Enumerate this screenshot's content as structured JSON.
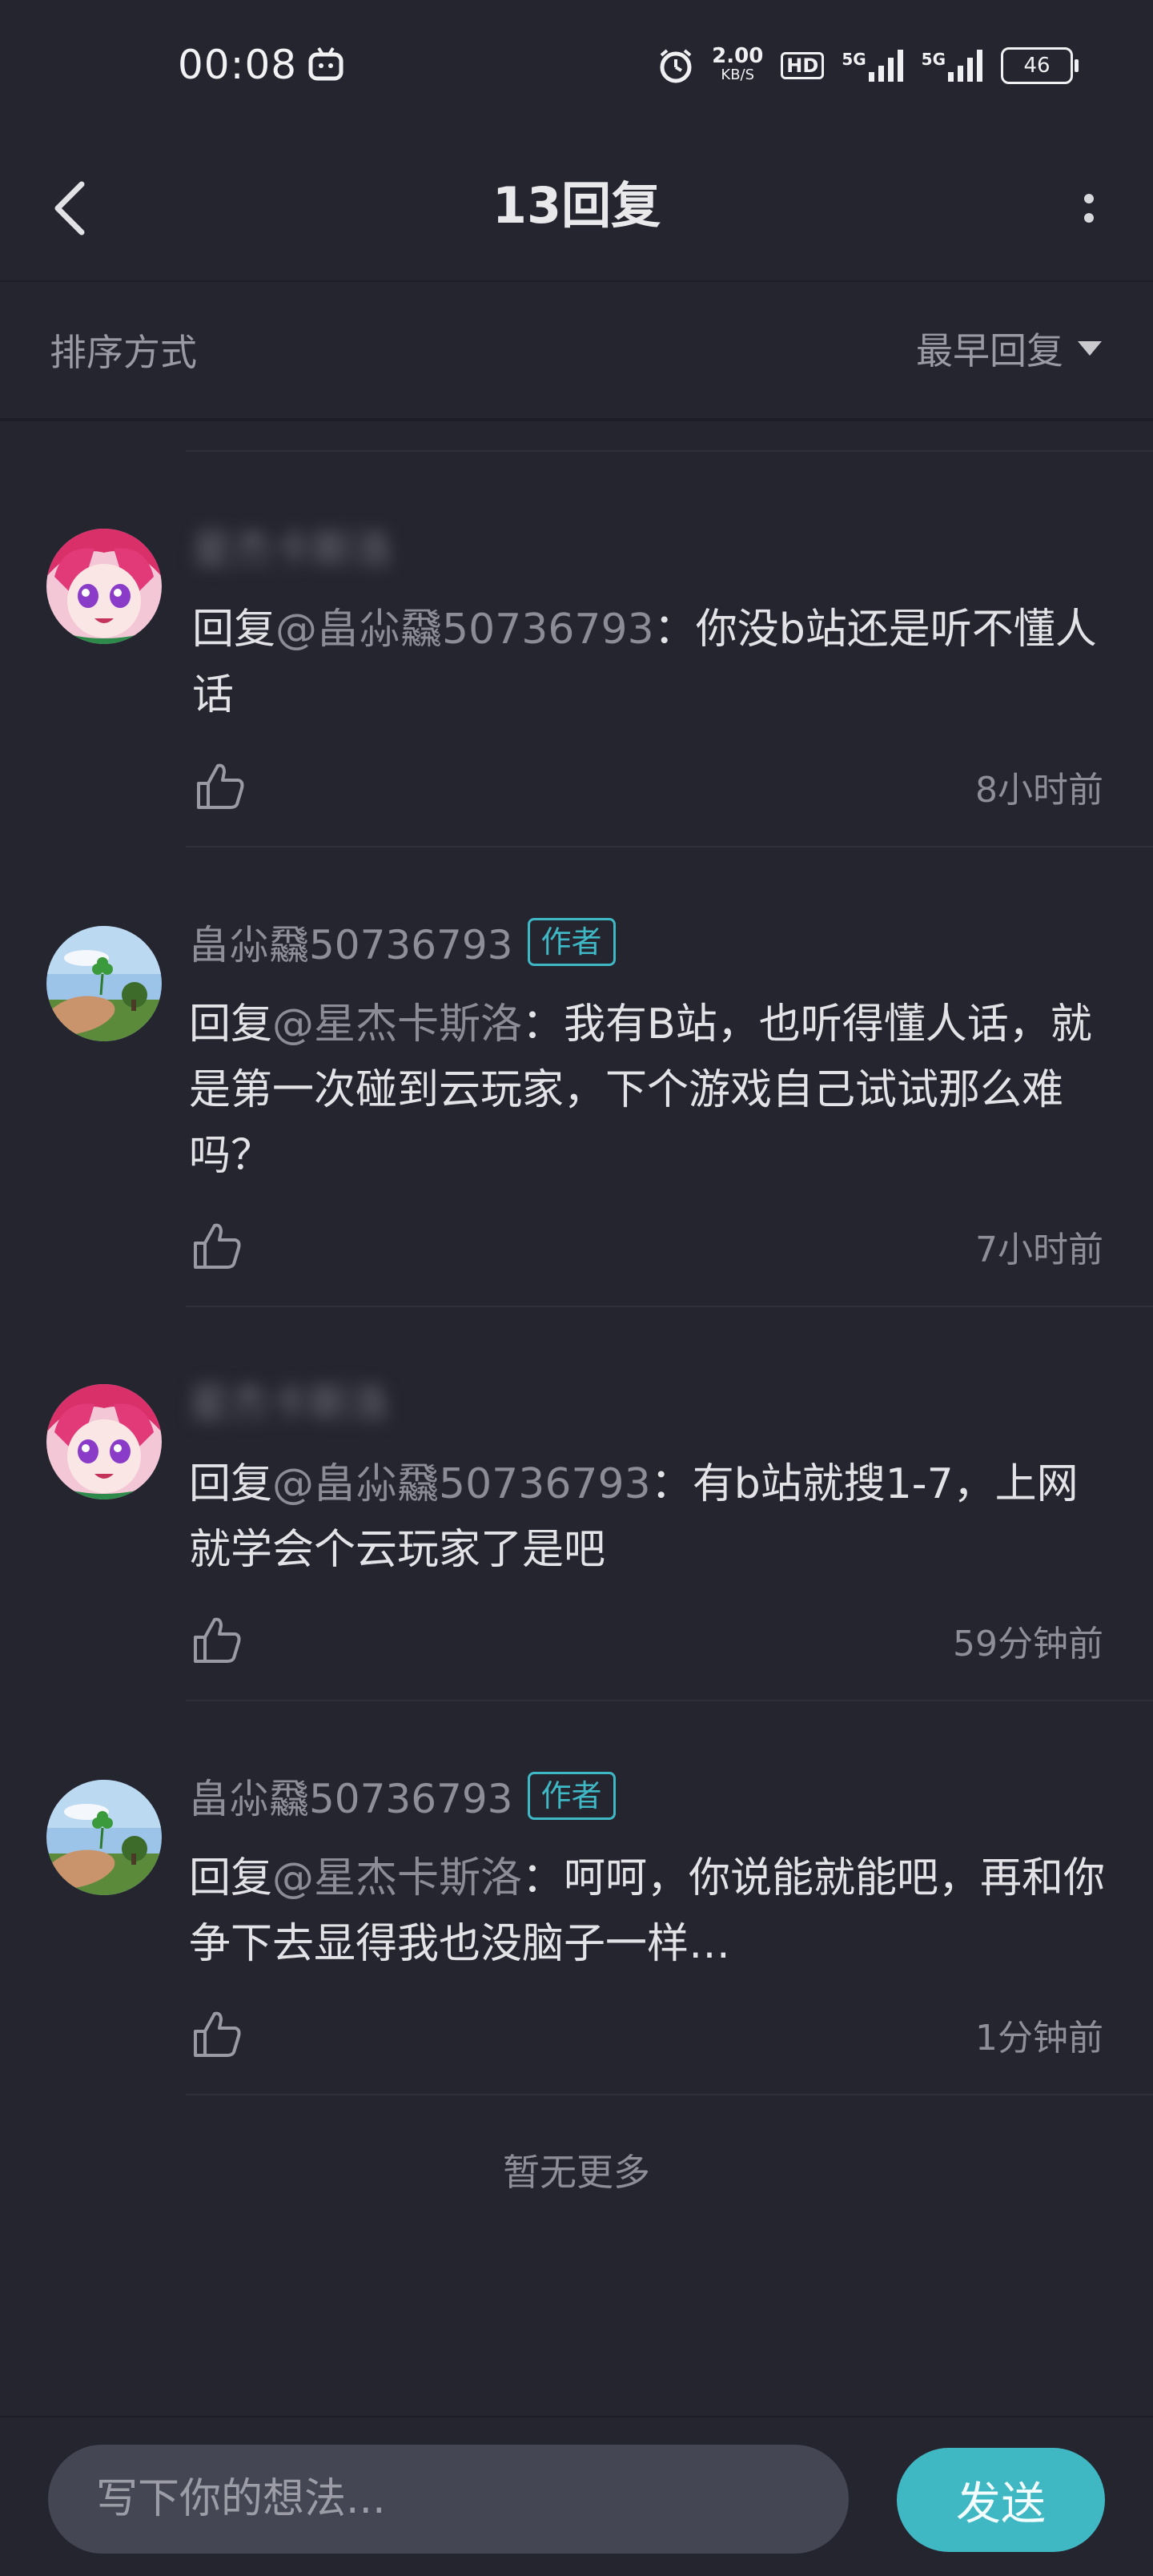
{
  "status_bar": {
    "time": "00:08",
    "net_speed_value": "2.00",
    "net_speed_unit": "KB/S",
    "hd_label": "HD",
    "signal_1": "5G",
    "signal_2": "5G",
    "battery": "46"
  },
  "header": {
    "title": "13回复"
  },
  "sort": {
    "label": "排序方式",
    "selected": "最早回复"
  },
  "comments": [
    {
      "username": "星杰卡斯洛",
      "is_author": false,
      "author_badge": "",
      "reply_prefix": "回复",
      "mention": "@畠尛飝50736793",
      "separator": "：",
      "text": "你没b站还是听不懂人话",
      "time": "8小时前"
    },
    {
      "username": "畠尛飝50736793",
      "is_author": true,
      "author_badge": "作者",
      "reply_prefix": "回复",
      "mention": "@星杰卡斯洛",
      "separator": "：",
      "text": "我有B站，也听得懂人话，就是第一次碰到云玩家，下个游戏自己试试那么难吗？",
      "time": "7小时前"
    },
    {
      "username": "星杰卡斯洛",
      "is_author": false,
      "author_badge": "",
      "reply_prefix": "回复",
      "mention": "@畠尛飝50736793",
      "separator": "：",
      "text": "有b站就搜1-7，上网就学会个云玩家了是吧",
      "time": "59分钟前"
    },
    {
      "username": "畠尛飝50736793",
      "is_author": true,
      "author_badge": "作者",
      "reply_prefix": "回复",
      "mention": "@星杰卡斯洛",
      "separator": "：",
      "text": "呵呵，你说能就能吧，再和你争下去显得我也没脑子一样…",
      "time": "1分钟前"
    }
  ],
  "footer_text": "暂无更多",
  "input": {
    "placeholder": "写下你的想法...",
    "value": ""
  },
  "send_label": "发送",
  "colors": {
    "background": "#25252f",
    "accent": "#40b8c4",
    "author_badge": "#3fb8c6",
    "muted_text": "#8e8e98"
  },
  "icons": [
    "back-arrow-icon",
    "more-vertical-icon",
    "dropdown-triangle-icon",
    "thumbs-up-icon",
    "alarm-icon",
    "tv-app-icon"
  ]
}
